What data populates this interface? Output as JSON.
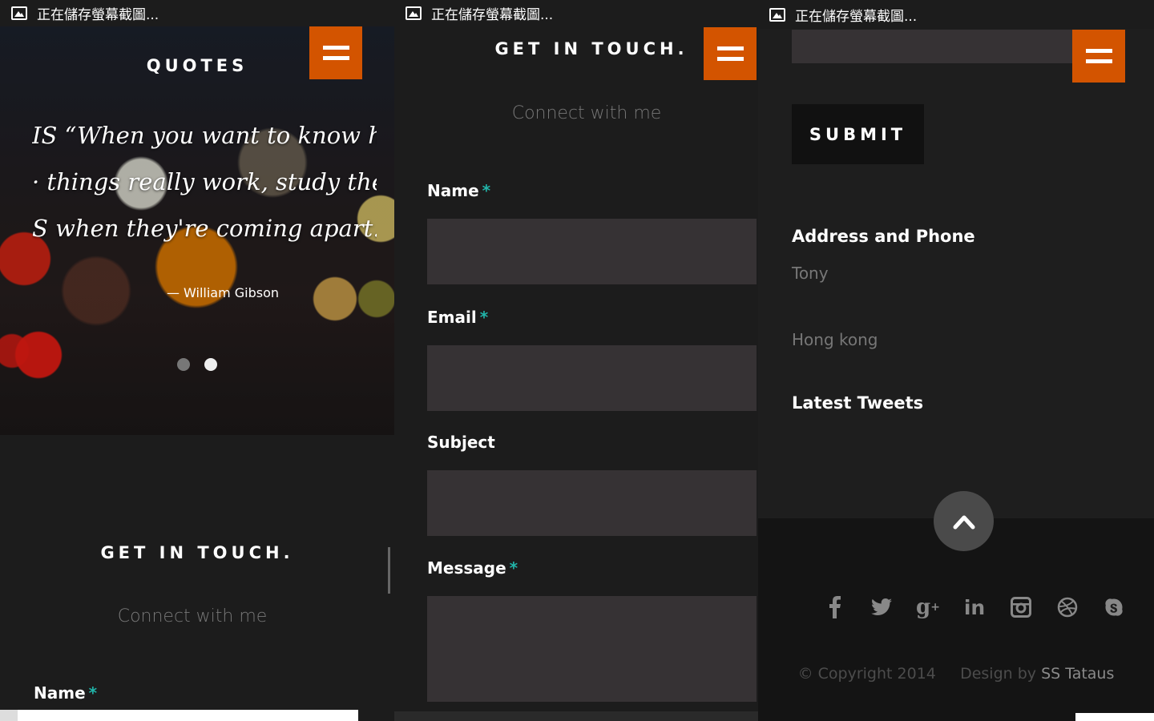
{
  "statusbar": {
    "saving_text": "正在儲存螢幕截圖..."
  },
  "colors": {
    "accent": "#d35400",
    "required": "#21b3a8",
    "field_bg": "#363234"
  },
  "panel1": {
    "quotes_title": "QUOTES",
    "quote_lines": [
      "IS  “When you want to know hoı",
      "  ·    things really work, study theı",
      "S      when they're coming apart.’"
    ],
    "quote_author": "— William Gibson",
    "contact_title": "GET IN TOUCH.",
    "contact_subtitle": "Connect with me",
    "name_label": "Name",
    "required_mark": "*"
  },
  "panel2": {
    "contact_title": "GET IN TOUCH.",
    "contact_subtitle": "Connect with me",
    "fields": {
      "name_label": "Name",
      "email_label": "Email",
      "subject_label": "Subject",
      "message_label": "Message"
    },
    "required_mark": "*"
  },
  "panel3": {
    "submit_label": "SUBMIT",
    "address_heading": "Address and Phone",
    "address_name": "Tony",
    "address_city": "Hong kong",
    "tweets_heading": "Latest Tweets",
    "social_icons": [
      "facebook-icon",
      "twitter-icon",
      "google-plus-icon",
      "linkedin-icon",
      "instagram-icon",
      "dribbble-icon",
      "skype-icon"
    ],
    "copyright": "© Copyright 2014",
    "design_by": "Design by",
    "designer": "SS Tataus"
  }
}
